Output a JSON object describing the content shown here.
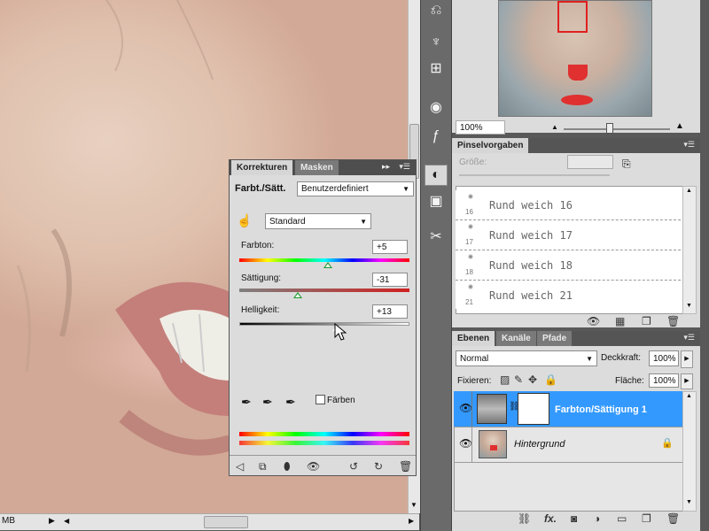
{
  "canvas": {
    "status_doc": "MB"
  },
  "navigator": {
    "zoom": "100%"
  },
  "adjustments": {
    "tabs": [
      "Korrekturen",
      "Masken"
    ],
    "title": "Farbt./Sätt.",
    "preset": "Benutzerdefiniert",
    "range": "Standard",
    "hue": {
      "label": "Farbton:",
      "value": "+5",
      "fraction": 0.52
    },
    "saturation": {
      "label": "Sättigung:",
      "value": "-31",
      "fraction": 0.345
    },
    "lightness": {
      "label": "Helligkeit:",
      "value": "+13",
      "fraction": 0.565
    },
    "colorize": "Färben"
  },
  "brushes": {
    "tab": "Pinselvorgaben",
    "size_label": "Größe:",
    "items": [
      {
        "size": "16",
        "name": "Rund weich 16"
      },
      {
        "size": "17",
        "name": "Rund weich 17"
      },
      {
        "size": "18",
        "name": "Rund weich 18"
      },
      {
        "size": "21",
        "name": "Rund weich 21"
      }
    ]
  },
  "layers": {
    "tabs": [
      "Ebenen",
      "Kanäle",
      "Pfade"
    ],
    "blend_mode": "Normal",
    "opacity_label": "Deckkraft:",
    "opacity": "100%",
    "lock_label": "Fixieren:",
    "fill_label": "Fläche:",
    "fill": "100%",
    "items": [
      {
        "name": "Farbton/Sättigung 1",
        "selected": true
      },
      {
        "name": "Hintergrund",
        "selected": false
      }
    ]
  },
  "colors": {
    "selection": "#3399ff",
    "panel": "#dcdcdc"
  }
}
